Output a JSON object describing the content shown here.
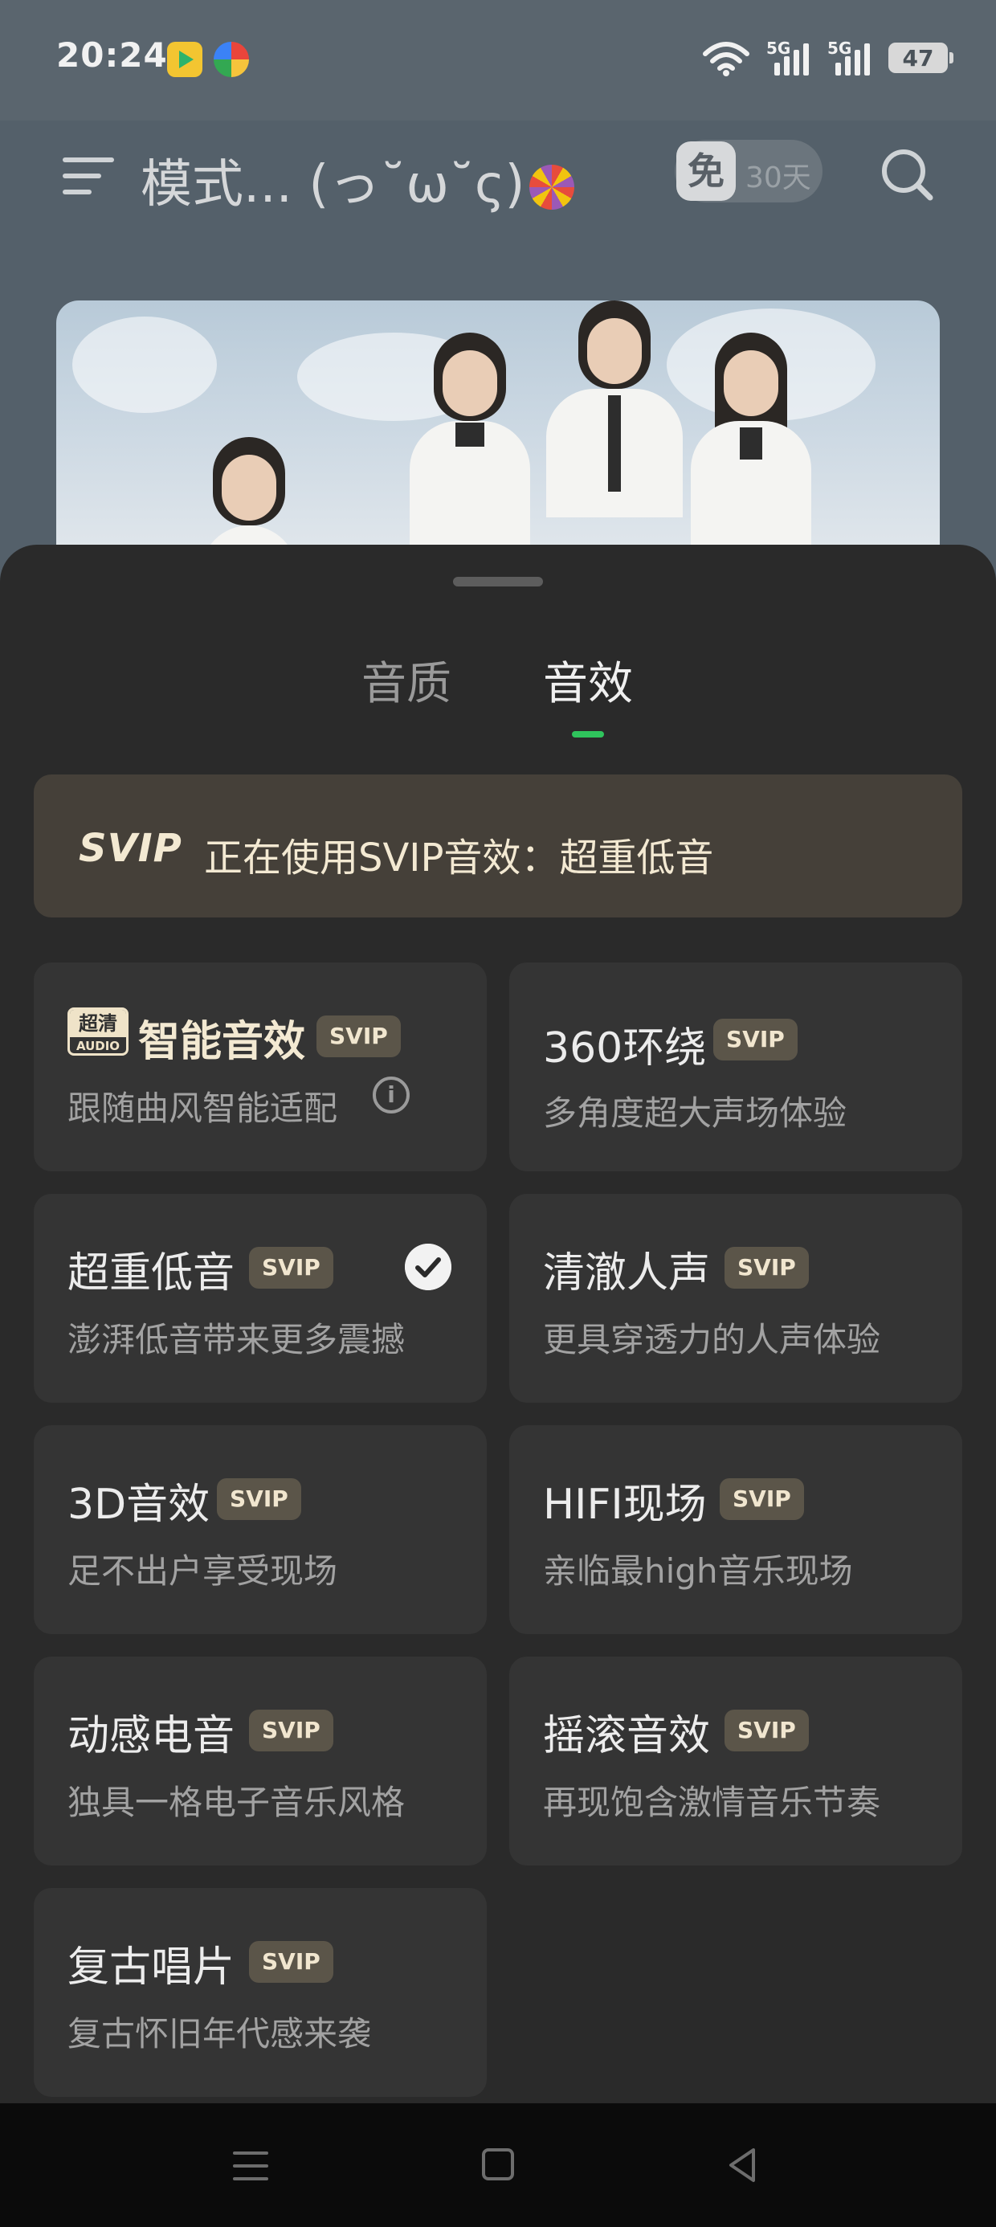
{
  "status_bar": {
    "time": "20:24",
    "network_1": "5G",
    "network_2": "5G",
    "battery": "47",
    "icons": [
      "app-icon-video",
      "app-icon-colorful",
      "wifi-icon",
      "signal-icon",
      "signal-icon",
      "battery-icon"
    ]
  },
  "header": {
    "title": "模式... (っ˘ω˘ς)",
    "vip_free_label": "免",
    "vip_days": "30天"
  },
  "sheet": {
    "tabs": [
      {
        "label": "音质",
        "active": false
      },
      {
        "label": "音效",
        "active": true
      }
    ],
    "notice": {
      "svip_logo": "SVIP",
      "text": "正在使用SVIP音效：超重低音"
    },
    "badge_label": "SVIP",
    "hq_logo_top": "超清",
    "hq_logo_bottom": "AUDIO",
    "effects": [
      {
        "title": "智能音效",
        "desc": "跟随曲风智能适配",
        "selected": false
      },
      {
        "title": "360环绕",
        "desc": "多角度超大声场体验",
        "selected": false
      },
      {
        "title": "超重低音",
        "desc": "澎湃低音带来更多震撼",
        "selected": true
      },
      {
        "title": "清澈人声",
        "desc": "更具穿透力的人声体验",
        "selected": false
      },
      {
        "title": "3D音效",
        "desc": "足不出户享受现场",
        "selected": false
      },
      {
        "title": "HIFI现场",
        "desc": "亲临最high音乐现场",
        "selected": false
      },
      {
        "title": "动感电音",
        "desc": "独具一格电子音乐风格",
        "selected": false
      },
      {
        "title": "摇滚音效",
        "desc": "再现饱含激情音乐节奏",
        "selected": false
      },
      {
        "title": "复古唱片",
        "desc": "复古怀旧年代感来袭",
        "selected": false
      }
    ]
  },
  "colors": {
    "accent_green": "#2fc45c",
    "sheet_bg": "#2a2a2a",
    "card_bg": "#343434",
    "svip_gold": "#f3e9d2"
  }
}
